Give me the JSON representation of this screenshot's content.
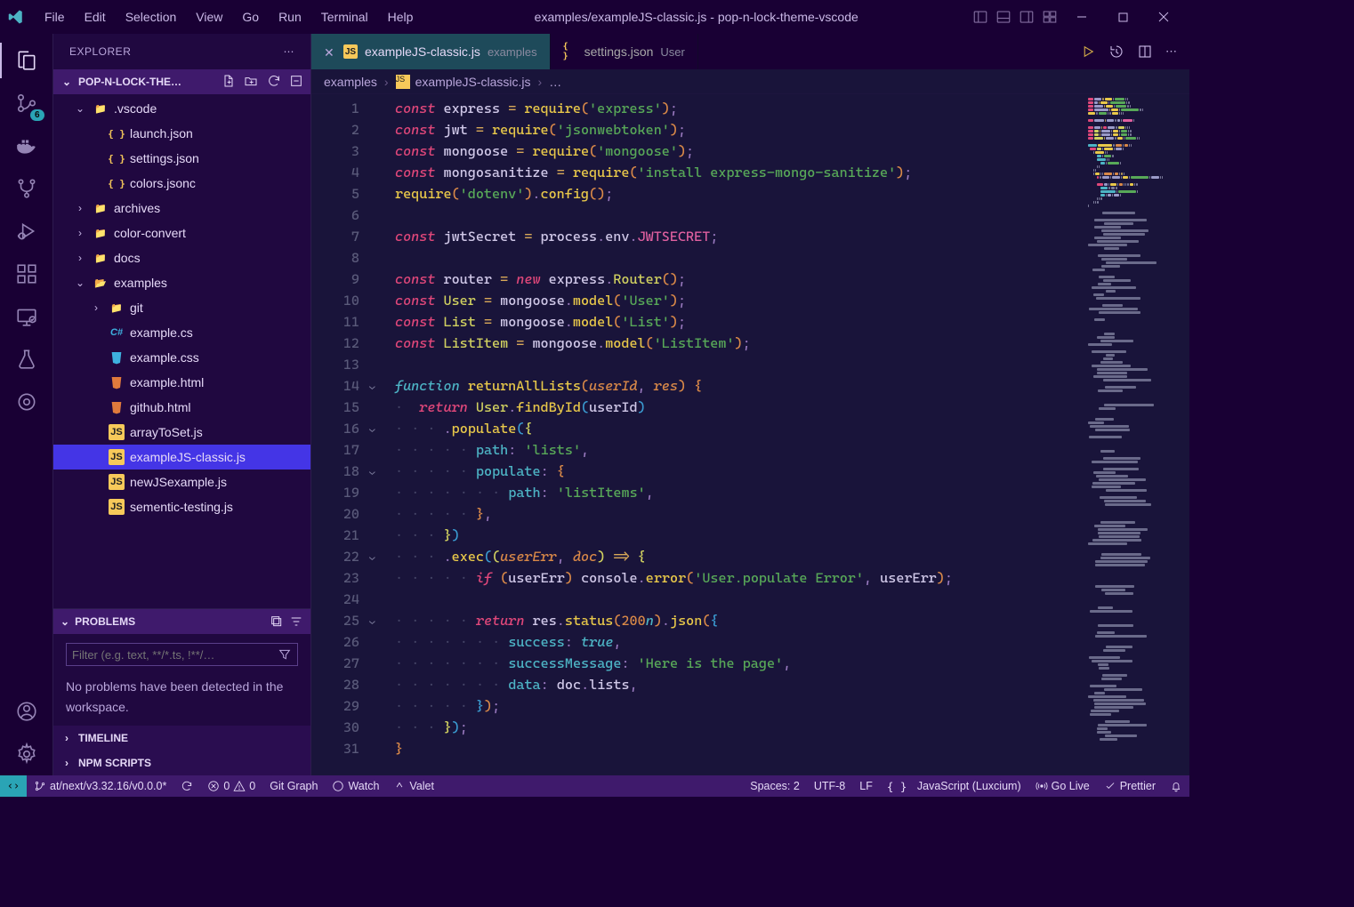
{
  "window": {
    "title": "examples/exampleJS-classic.js - pop-n-lock-theme-vscode"
  },
  "menu": [
    "File",
    "Edit",
    "Selection",
    "View",
    "Go",
    "Run",
    "Terminal",
    "Help"
  ],
  "activitybar": {
    "badge": "6"
  },
  "sidebar": {
    "title": "EXPLORER",
    "section": "POP-N-LOCK-THE…",
    "tree": [
      {
        "depth": 0,
        "tw": "⌄",
        "icon": "folder-blue",
        "label": ".vscode"
      },
      {
        "depth": 1,
        "tw": "",
        "icon": "json",
        "label": "launch.json"
      },
      {
        "depth": 1,
        "tw": "",
        "icon": "json",
        "label": "settings.json"
      },
      {
        "depth": 1,
        "tw": "",
        "icon": "json",
        "label": "colors.jsonc"
      },
      {
        "depth": 0,
        "tw": "›",
        "icon": "folder",
        "label": "archives"
      },
      {
        "depth": 0,
        "tw": "›",
        "icon": "folder",
        "label": "color-convert"
      },
      {
        "depth": 0,
        "tw": "›",
        "icon": "folder-blue",
        "label": "docs"
      },
      {
        "depth": 0,
        "tw": "⌄",
        "icon": "folder-open-blue",
        "label": "examples"
      },
      {
        "depth": 1,
        "tw": "›",
        "icon": "folder",
        "label": "git"
      },
      {
        "depth": 1,
        "tw": "",
        "icon": "cs",
        "label": "example.cs"
      },
      {
        "depth": 1,
        "tw": "",
        "icon": "css",
        "label": "example.css"
      },
      {
        "depth": 1,
        "tw": "",
        "icon": "html",
        "label": "example.html"
      },
      {
        "depth": 1,
        "tw": "",
        "icon": "html",
        "label": "github.html"
      },
      {
        "depth": 1,
        "tw": "",
        "icon": "js",
        "label": "arrayToSet.js"
      },
      {
        "depth": 1,
        "tw": "",
        "icon": "js",
        "label": "exampleJS-classic.js",
        "selected": true
      },
      {
        "depth": 1,
        "tw": "",
        "icon": "js",
        "label": "newJSexample.js"
      },
      {
        "depth": 1,
        "tw": "",
        "icon": "js",
        "label": "sementic-testing.js"
      }
    ],
    "problems": {
      "title": "PROBLEMS",
      "filter_placeholder": "Filter (e.g. text, **/*.ts, !**/…",
      "message": "No problems have been detected in the workspace."
    },
    "timeline": "TIMELINE",
    "npm": "NPM SCRIPTS"
  },
  "tabs": [
    {
      "icon": "js",
      "label": "exampleJS-classic.js",
      "desc": "examples",
      "active": true
    },
    {
      "icon": "json",
      "label": "settings.json",
      "desc": "User",
      "active": false
    }
  ],
  "breadcrumbs": [
    "examples",
    "exampleJS-classic.js",
    "…"
  ],
  "code": {
    "lines": [
      [
        [
          "kw",
          "const"
        ],
        [
          "",
          ""
        ],
        [
          "var",
          "express"
        ],
        [
          "",
          ""
        ],
        [
          "op",
          "="
        ],
        [
          "",
          ""
        ],
        [
          "fn",
          "require"
        ],
        [
          "paren",
          "("
        ],
        [
          "str",
          "'express'"
        ],
        [
          "paren",
          ")"
        ],
        [
          "punc",
          ";"
        ]
      ],
      [
        [
          "kw",
          "const"
        ],
        [
          "",
          ""
        ],
        [
          "var",
          "jwt"
        ],
        [
          "",
          ""
        ],
        [
          "op",
          "="
        ],
        [
          "",
          ""
        ],
        [
          "fn",
          "require"
        ],
        [
          "paren",
          "("
        ],
        [
          "str",
          "'jsonwebtoken'"
        ],
        [
          "paren",
          ")"
        ],
        [
          "punc",
          ";"
        ]
      ],
      [
        [
          "kw",
          "const"
        ],
        [
          "",
          ""
        ],
        [
          "var",
          "mongoose"
        ],
        [
          "",
          ""
        ],
        [
          "op",
          "="
        ],
        [
          "",
          ""
        ],
        [
          "fn",
          "require"
        ],
        [
          "paren",
          "("
        ],
        [
          "str",
          "'mongoose'"
        ],
        [
          "paren",
          ")"
        ],
        [
          "punc",
          ";"
        ]
      ],
      [
        [
          "kw",
          "const"
        ],
        [
          "",
          ""
        ],
        [
          "var",
          "mongosanitize"
        ],
        [
          "",
          ""
        ],
        [
          "op",
          "="
        ],
        [
          "",
          ""
        ],
        [
          "fn",
          "require"
        ],
        [
          "paren",
          "("
        ],
        [
          "str",
          "'install express-mongo-sanitize'"
        ],
        [
          "paren",
          ")"
        ],
        [
          "punc",
          ";"
        ]
      ],
      [
        [
          "fn",
          "require"
        ],
        [
          "paren",
          "("
        ],
        [
          "str",
          "'dotenv'"
        ],
        [
          "paren",
          ")"
        ],
        [
          "punc",
          "."
        ],
        [
          "fn",
          "config"
        ],
        [
          "paren",
          "("
        ],
        [
          "paren",
          ")"
        ],
        [
          "punc",
          ";"
        ]
      ],
      [],
      [
        [
          "kw",
          "const"
        ],
        [
          "",
          ""
        ],
        [
          "var",
          "jwtSecret"
        ],
        [
          "",
          ""
        ],
        [
          "op",
          "="
        ],
        [
          "",
          ""
        ],
        [
          "var",
          "process"
        ],
        [
          "punc",
          "."
        ],
        [
          "var",
          "env"
        ],
        [
          "punc",
          "."
        ],
        [
          "const",
          "JWTSECRET"
        ],
        [
          "punc",
          ";"
        ]
      ],
      [],
      [
        [
          "kw",
          "const"
        ],
        [
          "",
          ""
        ],
        [
          "var",
          "router"
        ],
        [
          "",
          ""
        ],
        [
          "op",
          "="
        ],
        [
          "",
          ""
        ],
        [
          "kw",
          "new"
        ],
        [
          "",
          ""
        ],
        [
          "var",
          "express"
        ],
        [
          "punc",
          "."
        ],
        [
          "class",
          "Router"
        ],
        [
          "paren",
          "("
        ],
        [
          "paren",
          ")"
        ],
        [
          "punc",
          ";"
        ]
      ],
      [
        [
          "kw",
          "const"
        ],
        [
          "",
          ""
        ],
        [
          "class",
          "User"
        ],
        [
          "",
          ""
        ],
        [
          "op",
          "="
        ],
        [
          "",
          ""
        ],
        [
          "var",
          "mongoose"
        ],
        [
          "punc",
          "."
        ],
        [
          "fn",
          "model"
        ],
        [
          "paren",
          "("
        ],
        [
          "str",
          "'User'"
        ],
        [
          "paren",
          ")"
        ],
        [
          "punc",
          ";"
        ]
      ],
      [
        [
          "kw",
          "const"
        ],
        [
          "",
          ""
        ],
        [
          "class",
          "List"
        ],
        [
          "",
          ""
        ],
        [
          "op",
          "="
        ],
        [
          "",
          ""
        ],
        [
          "var",
          "mongoose"
        ],
        [
          "punc",
          "."
        ],
        [
          "fn",
          "model"
        ],
        [
          "paren",
          "("
        ],
        [
          "str",
          "'List'"
        ],
        [
          "paren",
          ")"
        ],
        [
          "punc",
          ";"
        ]
      ],
      [
        [
          "kw",
          "const"
        ],
        [
          "",
          ""
        ],
        [
          "class",
          "ListItem"
        ],
        [
          "",
          ""
        ],
        [
          "op",
          "="
        ],
        [
          "",
          ""
        ],
        [
          "var",
          "mongoose"
        ],
        [
          "punc",
          "."
        ],
        [
          "fn",
          "model"
        ],
        [
          "paren",
          "("
        ],
        [
          "str",
          "'ListItem'"
        ],
        [
          "paren",
          ")"
        ],
        [
          "punc",
          ";"
        ]
      ],
      [],
      [
        [
          "kw2",
          "function"
        ],
        [
          "",
          ""
        ],
        [
          "fn",
          "returnAllLists"
        ],
        [
          "paren",
          "("
        ],
        [
          "param",
          "userId"
        ],
        [
          "punc",
          ","
        ],
        [
          "",
          ""
        ],
        [
          "param",
          "res"
        ],
        [
          "paren",
          ")"
        ],
        [
          "",
          ""
        ],
        [
          "paren",
          "{"
        ]
      ],
      [
        [
          "dim",
          "·"
        ],
        [
          "",
          ""
        ],
        [
          "kw",
          "return"
        ],
        [
          "",
          ""
        ],
        [
          "class",
          "User"
        ],
        [
          "punc",
          "."
        ],
        [
          "fn",
          "findById"
        ],
        [
          "paren2",
          "("
        ],
        [
          "var",
          "userId"
        ],
        [
          "paren2",
          ")"
        ]
      ],
      [
        [
          "dim",
          "·"
        ],
        [
          "dim",
          "·"
        ],
        [
          "dim",
          "·"
        ],
        [
          "punc",
          "."
        ],
        [
          "fn",
          "populate"
        ],
        [
          "paren2",
          "("
        ],
        [
          "paren3",
          "{"
        ]
      ],
      [
        [
          "dim",
          "·"
        ],
        [
          "dim",
          "·"
        ],
        [
          "dim",
          "·"
        ],
        [
          "dim",
          "·"
        ],
        [
          "dim",
          "·"
        ],
        [
          "prop",
          "path"
        ],
        [
          "punc",
          ":"
        ],
        [
          "",
          ""
        ],
        [
          "str",
          "'lists'"
        ],
        [
          "punc",
          ","
        ]
      ],
      [
        [
          "dim",
          "·"
        ],
        [
          "dim",
          "·"
        ],
        [
          "dim",
          "·"
        ],
        [
          "dim",
          "·"
        ],
        [
          "dim",
          "·"
        ],
        [
          "prop",
          "populate"
        ],
        [
          "punc",
          ":"
        ],
        [
          "",
          ""
        ],
        [
          "paren",
          "{"
        ]
      ],
      [
        [
          "dim",
          "·"
        ],
        [
          "dim",
          "·"
        ],
        [
          "dim",
          "·"
        ],
        [
          "dim",
          "·"
        ],
        [
          "dim",
          "·"
        ],
        [
          "dim",
          "·"
        ],
        [
          "dim",
          "·"
        ],
        [
          "prop",
          "path"
        ],
        [
          "punc",
          ":"
        ],
        [
          "",
          ""
        ],
        [
          "str",
          "'listItems'"
        ],
        [
          "punc",
          ","
        ]
      ],
      [
        [
          "dim",
          "·"
        ],
        [
          "dim",
          "·"
        ],
        [
          "dim",
          "·"
        ],
        [
          "dim",
          "·"
        ],
        [
          "dim",
          "·"
        ],
        [
          "paren",
          "}"
        ],
        [
          "punc",
          ","
        ]
      ],
      [
        [
          "dim",
          "·"
        ],
        [
          "dim",
          "·"
        ],
        [
          "dim",
          "·"
        ],
        [
          "paren3",
          "}"
        ],
        [
          "paren2",
          ")"
        ]
      ],
      [
        [
          "dim",
          "·"
        ],
        [
          "dim",
          "·"
        ],
        [
          "dim",
          "·"
        ],
        [
          "punc",
          "."
        ],
        [
          "fn",
          "exec"
        ],
        [
          "paren2",
          "("
        ],
        [
          "paren3",
          "("
        ],
        [
          "param",
          "userErr"
        ],
        [
          "punc",
          ","
        ],
        [
          "",
          ""
        ],
        [
          "param",
          "doc"
        ],
        [
          "paren3",
          ")"
        ],
        [
          "",
          ""
        ],
        [
          "op",
          "=>"
        ],
        [
          "",
          ""
        ],
        [
          "paren3",
          "{"
        ]
      ],
      [
        [
          "dim",
          "·"
        ],
        [
          "dim",
          "·"
        ],
        [
          "dim",
          "·"
        ],
        [
          "dim",
          "·"
        ],
        [
          "dim",
          "·"
        ],
        [
          "kw",
          "if"
        ],
        [
          "",
          ""
        ],
        [
          "paren",
          "("
        ],
        [
          "var",
          "userErr"
        ],
        [
          "paren",
          ")"
        ],
        [
          "",
          ""
        ],
        [
          "var",
          "console"
        ],
        [
          "punc",
          "."
        ],
        [
          "fn",
          "error"
        ],
        [
          "paren",
          "("
        ],
        [
          "str",
          "'User.populate Error'"
        ],
        [
          "punc",
          ","
        ],
        [
          "",
          ""
        ],
        [
          "var",
          "userErr"
        ],
        [
          "paren",
          ")"
        ],
        [
          "punc",
          ";"
        ]
      ],
      [],
      [
        [
          "dim",
          "·"
        ],
        [
          "dim",
          "·"
        ],
        [
          "dim",
          "·"
        ],
        [
          "dim",
          "·"
        ],
        [
          "dim",
          "·"
        ],
        [
          "kw",
          "return"
        ],
        [
          "",
          ""
        ],
        [
          "var",
          "res"
        ],
        [
          "punc",
          "."
        ],
        [
          "fn",
          "status"
        ],
        [
          "paren",
          "("
        ],
        [
          "num",
          "200"
        ],
        [
          "num-sfx",
          "n"
        ],
        [
          "paren",
          ")"
        ],
        [
          "punc",
          "."
        ],
        [
          "fn",
          "json"
        ],
        [
          "paren",
          "("
        ],
        [
          "paren2",
          "{"
        ]
      ],
      [
        [
          "dim",
          "·"
        ],
        [
          "dim",
          "·"
        ],
        [
          "dim",
          "·"
        ],
        [
          "dim",
          "·"
        ],
        [
          "dim",
          "·"
        ],
        [
          "dim",
          "·"
        ],
        [
          "dim",
          "·"
        ],
        [
          "prop",
          "success"
        ],
        [
          "punc",
          ":"
        ],
        [
          "",
          ""
        ],
        [
          "bool",
          "true"
        ],
        [
          "punc",
          ","
        ]
      ],
      [
        [
          "dim",
          "·"
        ],
        [
          "dim",
          "·"
        ],
        [
          "dim",
          "·"
        ],
        [
          "dim",
          "·"
        ],
        [
          "dim",
          "·"
        ],
        [
          "dim",
          "·"
        ],
        [
          "dim",
          "·"
        ],
        [
          "prop",
          "successMessage"
        ],
        [
          "punc",
          ":"
        ],
        [
          "",
          ""
        ],
        [
          "str",
          "'Here is the page'"
        ],
        [
          "punc",
          ","
        ]
      ],
      [
        [
          "dim",
          "·"
        ],
        [
          "dim",
          "·"
        ],
        [
          "dim",
          "·"
        ],
        [
          "dim",
          "·"
        ],
        [
          "dim",
          "·"
        ],
        [
          "dim",
          "·"
        ],
        [
          "dim",
          "·"
        ],
        [
          "prop",
          "data"
        ],
        [
          "punc",
          ":"
        ],
        [
          "",
          ""
        ],
        [
          "var",
          "doc"
        ],
        [
          "punc",
          "."
        ],
        [
          "var",
          "lists"
        ],
        [
          "punc",
          ","
        ]
      ],
      [
        [
          "dim",
          "·"
        ],
        [
          "dim",
          "·"
        ],
        [
          "dim",
          "·"
        ],
        [
          "dim",
          "·"
        ],
        [
          "dim",
          "·"
        ],
        [
          "paren2",
          "}"
        ],
        [
          "paren",
          ")"
        ],
        [
          "punc",
          ";"
        ]
      ],
      [
        [
          "dim",
          "·"
        ],
        [
          "dim",
          "·"
        ],
        [
          "dim",
          "·"
        ],
        [
          "paren3",
          "}"
        ],
        [
          "paren2",
          ")"
        ],
        [
          "punc",
          ";"
        ]
      ],
      [
        [
          "paren",
          "}"
        ]
      ]
    ],
    "folds": {
      "14": true,
      "16": true,
      "18": true,
      "22": true,
      "25": true
    }
  },
  "statusbar": {
    "branch": "at/next/v3.32.16/v0.0.0*",
    "errors": "0",
    "warnings": "0",
    "gitgraph": "Git Graph",
    "watch": "Watch",
    "valet": "Valet",
    "spaces": "Spaces: 2",
    "encoding": "UTF-8",
    "eol": "LF",
    "language": "JavaScript (Luxcium)",
    "golive": "Go Live",
    "prettier": "Prettier"
  }
}
